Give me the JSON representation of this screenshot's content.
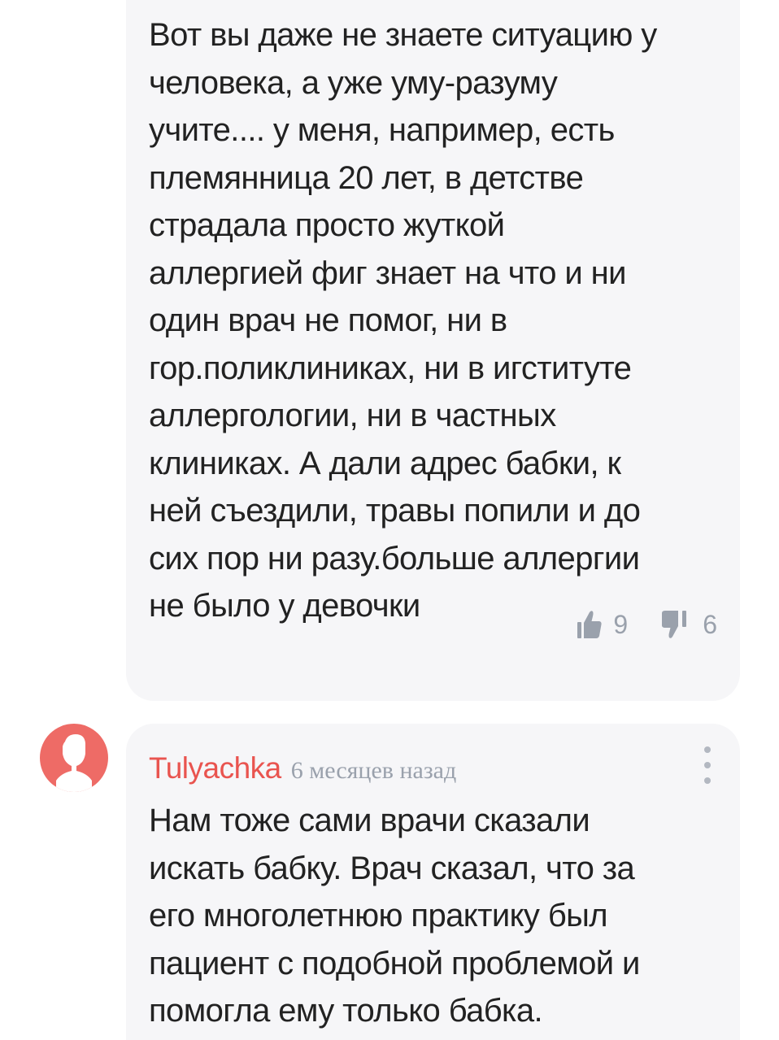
{
  "comments": [
    {
      "text": "Вот вы даже не знаете ситуацию у\nчеловека, а уже уму-разуму\nучите.... у меня, например, есть\nплемянница 20 лет, в детстве\nстрадала просто жуткой\nаллергией фиг знает на что и ни\nодин врач не помог, ни в\nгор.поликлиниках, ни в игституте\nаллергологии, ни в частных\nклиниках. А дали адрес бабки, к\nней съездили, травы попили и до\nсих пор ни разу.больше аллергии\nне было у девочки",
      "likes": "9",
      "dislikes": "6",
      "like_icon": "thumbs-up-icon",
      "dislike_icon": "thumbs-down-icon"
    },
    {
      "author": "Tulyachka",
      "time": "6 месяцев назад",
      "avatar_icon": "user-silhouette-icon",
      "menu_icon": "more-vertical-icon",
      "text": "Нам тоже сами врачи сказали\nискать бабку. Врач сказал, что за\nего многолетнюю практику был\nпациент с подобной проблемой и\nпомогла ему только бабка."
    }
  ],
  "colors": {
    "card_background": "#f6f6f8",
    "text": "#222222",
    "author": "#e9544f",
    "avatar": "#ee6b66",
    "muted": "#9aa1ac"
  }
}
